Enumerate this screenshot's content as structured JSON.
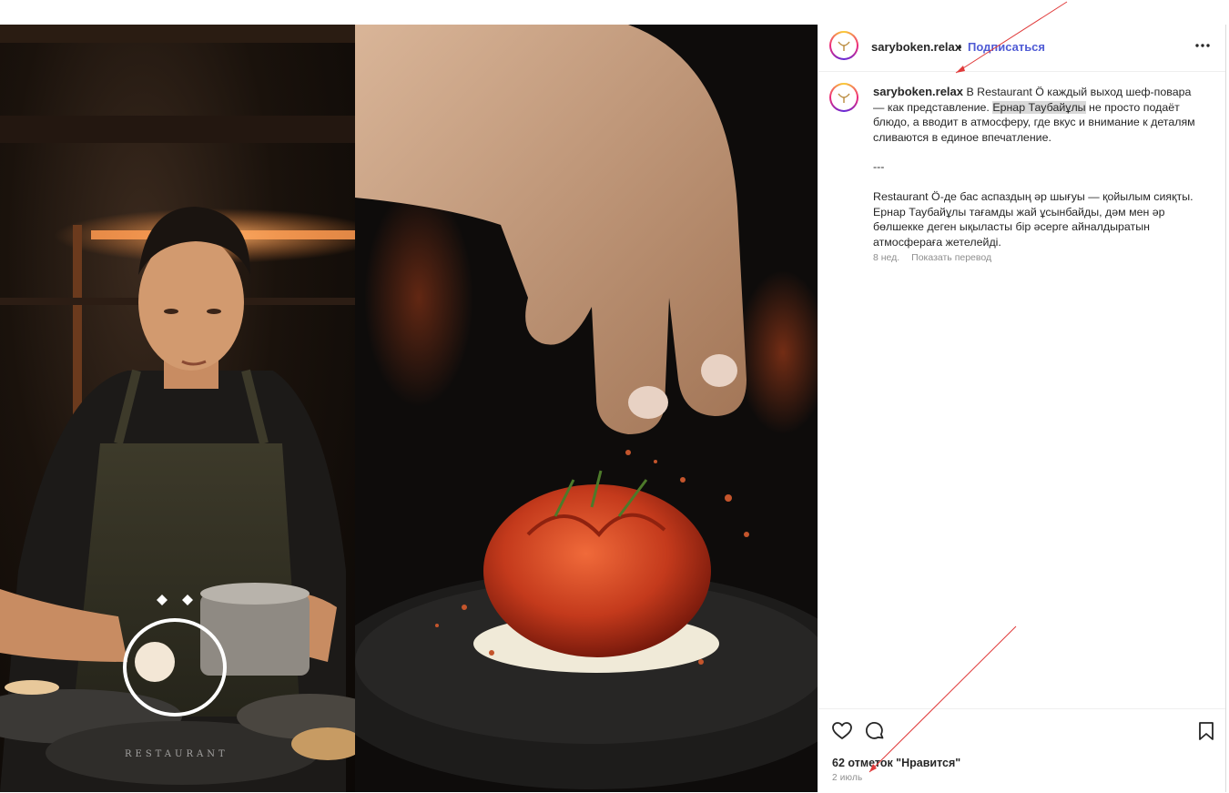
{
  "post": {
    "username": "saryboken.relax",
    "separator": "•",
    "follow_label": "Подписаться",
    "more_icon": "more-horizontal-icon"
  },
  "photo": {
    "brand_text": "RESTAURANT"
  },
  "caption": {
    "username": "saryboken.relax",
    "text_part1": " В Restaurant Ö каждый выход шеф-повара — как представление. ",
    "text_highlight": "Ернар Таубайұлы",
    "text_part2": " не просто подаёт блюдо, а вводит в атмосферу, где вкус и внимание к деталям сливаются в единое впечатление.",
    "divider": "---",
    "text_kazakh": "Restaurant Ö-де бас аспаздың әр шығуы — қойылым сияқты. Ернар Таубайұлы тағамды жай ұсынбайды, дәм мен әр бөлшекке деген ықыласты бір әсерге айналдыратын атмосфераға жетелейді.",
    "time_ago": "8 нед.",
    "translate_label": "Показать перевод"
  },
  "actions": {
    "like_icon": "heart-icon",
    "comment_icon": "comment-icon",
    "save_icon": "bookmark-icon",
    "likes_text": "62 отметок \"Нравится\"",
    "date": "2 июль"
  },
  "colors": {
    "accent": "#4f5bd5",
    "text": "#262626",
    "muted": "#8e8e8e",
    "annotation": "#e03a3a"
  }
}
